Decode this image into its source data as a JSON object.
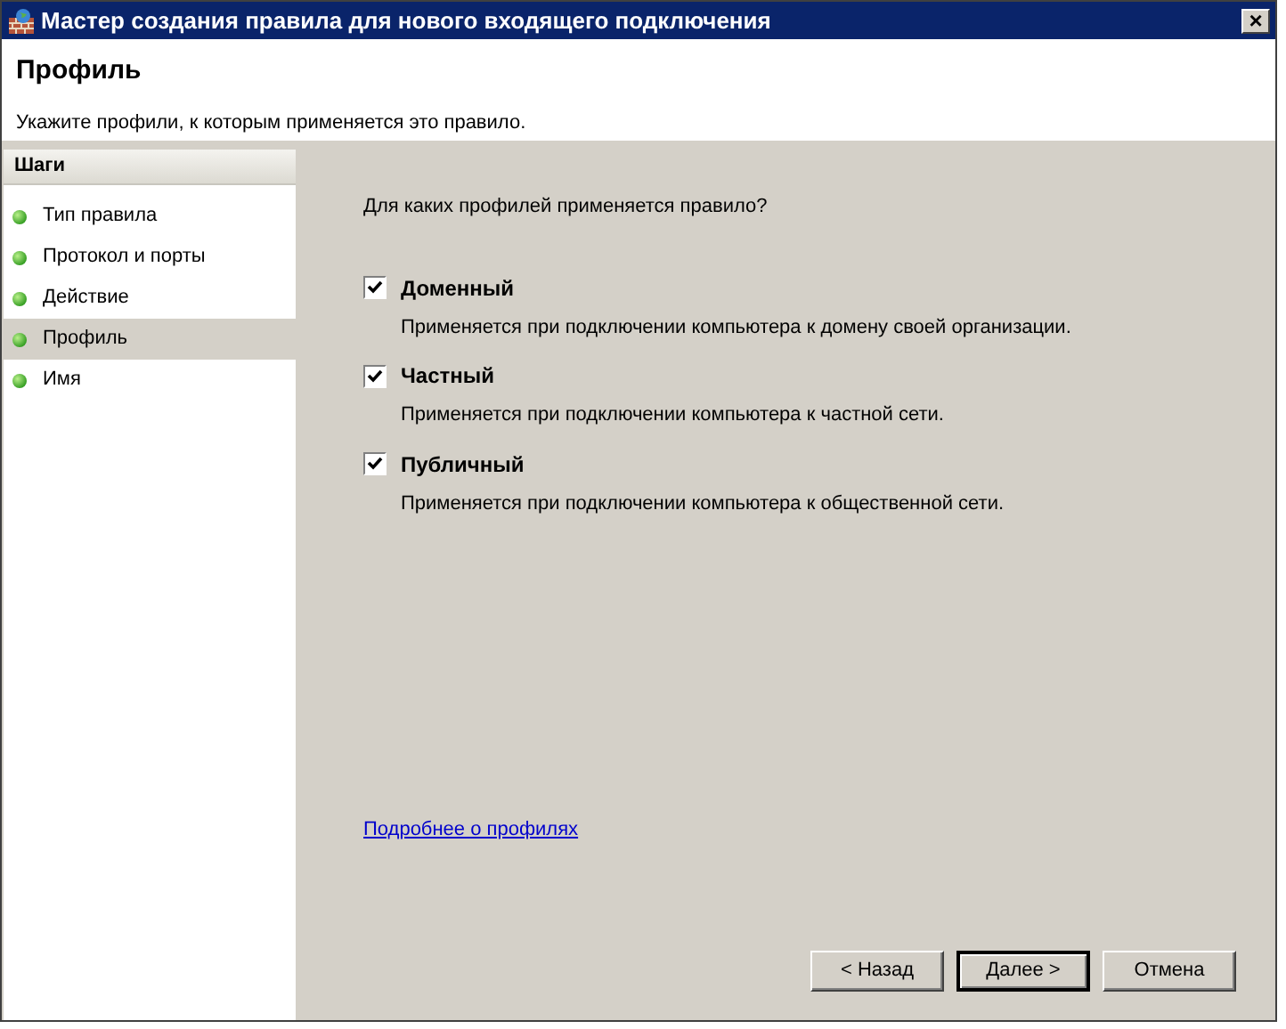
{
  "window": {
    "title": "Мастер создания правила для нового входящего подключения",
    "close": "×"
  },
  "header": {
    "title": "Профиль",
    "description": "Укажите профили, к которым применяется это правило."
  },
  "steps": {
    "heading": "Шаги",
    "items": [
      {
        "label": "Тип правила",
        "selected": false
      },
      {
        "label": "Протокол и порты",
        "selected": false
      },
      {
        "label": "Действие",
        "selected": false
      },
      {
        "label": "Профиль",
        "selected": true
      },
      {
        "label": "Имя",
        "selected": false
      }
    ]
  },
  "question": "Для каких профилей применяется правило?",
  "profiles": [
    {
      "label": "Доменный",
      "description": "Применяется при подключении компьютера к домену своей организации.",
      "checked": true
    },
    {
      "label": "Частный",
      "description": "Применяется при подключении компьютера к частной сети.",
      "checked": true
    },
    {
      "label": "Публичный",
      "description": "Применяется при подключении компьютера к общественной сети.",
      "checked": true
    }
  ],
  "link": "Подробнее о профилях",
  "buttons": [
    {
      "label": "< Назад",
      "default": false
    },
    {
      "label": "Далее >",
      "default": true
    },
    {
      "label": "Отмена",
      "default": false
    }
  ]
}
